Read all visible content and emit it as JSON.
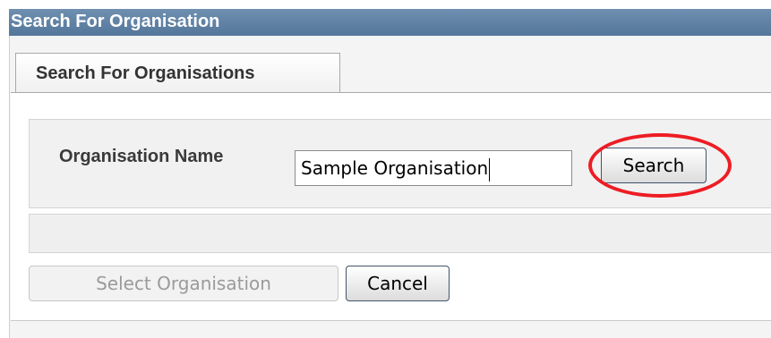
{
  "window": {
    "title": "Search For Organisation"
  },
  "tabs": [
    {
      "label": "Search For Organisations",
      "active": true
    }
  ],
  "search": {
    "field_label": "Organisation Name",
    "input_value": "Sample Organisation",
    "button_label": "Search",
    "highlight_color": "#ee1c24"
  },
  "status": {
    "text": ""
  },
  "actions": {
    "select_label": "Select Organisation",
    "select_enabled": false,
    "cancel_label": "Cancel"
  },
  "colors": {
    "title_bar": "#5f82a6",
    "panel_bg": "#f4f4f4",
    "button_border": "#42536b"
  }
}
